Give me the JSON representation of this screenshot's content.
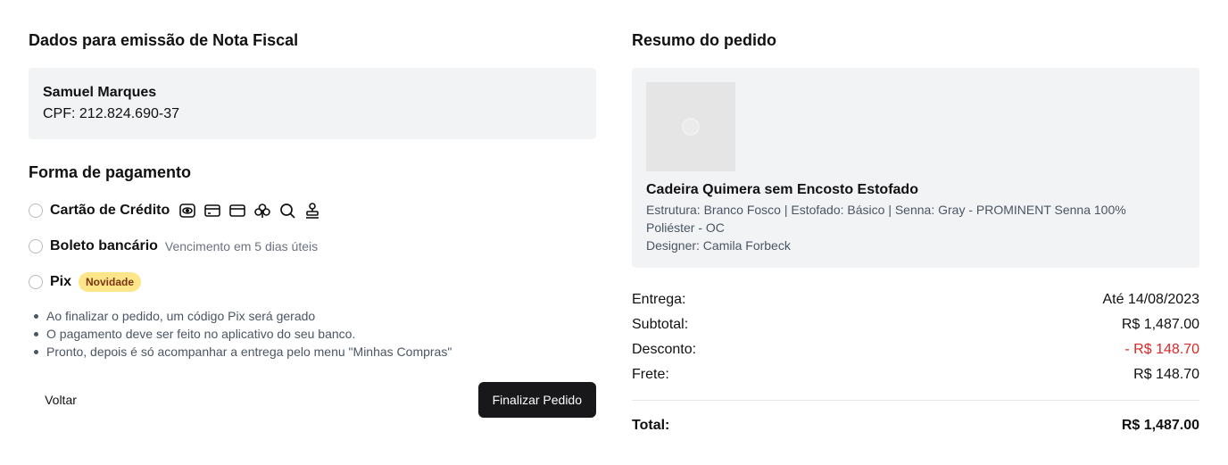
{
  "invoice": {
    "title": "Dados para emissão de Nota Fiscal",
    "name": "Samuel Marques",
    "cpf": "CPF: 212.824.690-37"
  },
  "payment": {
    "title": "Forma de pagamento",
    "options": [
      {
        "label": "Cartão de Crédito",
        "icons": [
          "eye-card-icon",
          "credit-card-icon",
          "credit-card-icon",
          "club-icon",
          "search-icon",
          "stamp-icon"
        ]
      },
      {
        "label": "Boleto bancário",
        "note": "Vencimento em 5 dias úteis"
      },
      {
        "label": "Pix",
        "badge": "Novidade"
      }
    ],
    "pix_info": [
      "Ao finalizar o pedido, um código Pix será gerado",
      "O pagamento deve ser feito no aplicativo do seu banco.",
      "Pronto, depois é só acompanhar a entrega pelo menu \"Minhas Compras\""
    ]
  },
  "actions": {
    "back": "Voltar",
    "finish": "Finalizar Pedido"
  },
  "summary": {
    "title": "Resumo do pedido",
    "product": {
      "name": "Cadeira Quimera sem Encosto Estofado",
      "detail": "Estrutura: Branco Fosco | Estofado: Básico | Senna: Gray - PROMINENT Senna 100% Poliéster - OC",
      "designer": "Designer: Camila Forbeck"
    },
    "rows": [
      {
        "label": "Entrega:",
        "value": "Até 14/08/2023"
      },
      {
        "label": "Subtotal:",
        "value": "R$ 1,487.00"
      },
      {
        "label": "Desconto:",
        "value": "- R$ 148.70"
      },
      {
        "label": "Frete:",
        "value": "R$ 148.70"
      }
    ],
    "total": {
      "label": "Total:",
      "value": "R$ 1,487.00"
    },
    "colors": {
      "discount": "#dc2626"
    }
  }
}
